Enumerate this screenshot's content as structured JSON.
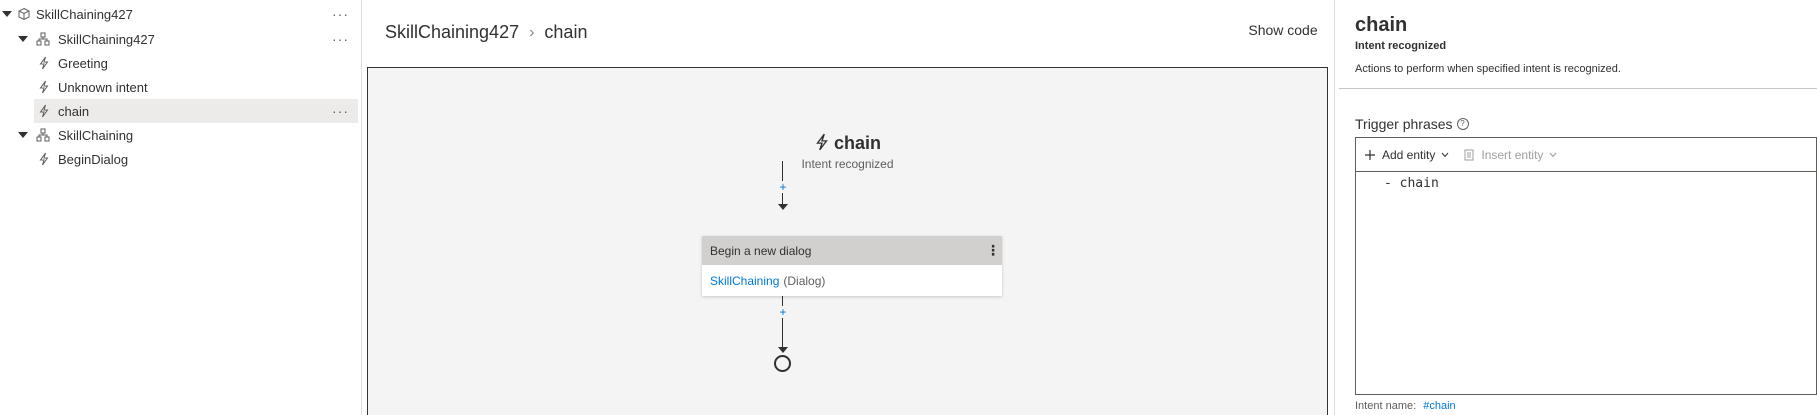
{
  "tree": {
    "items": [
      {
        "label": "SkillChaining427",
        "icon": "cube-icon",
        "more": "···"
      },
      {
        "label": "SkillChaining427",
        "icon": "dialog-hierarchy-icon",
        "more": "···"
      },
      {
        "label": "Greeting",
        "icon": "lightning-icon"
      },
      {
        "label": "Unknown intent",
        "icon": "lightning-icon"
      },
      {
        "label": "chain",
        "icon": "lightning-icon",
        "more": "···",
        "selected": true
      },
      {
        "label": "SkillChaining",
        "icon": "dialog-hierarchy-icon"
      },
      {
        "label": "BeginDialog",
        "icon": "lightning-icon"
      }
    ]
  },
  "header": {
    "breadcrumb": [
      "SkillChaining427",
      "chain"
    ],
    "breadcrumb_sep": "›",
    "show_code": "Show code"
  },
  "flow": {
    "trigger_title": "chain",
    "trigger_subtitle": "Intent recognized",
    "plus": "+",
    "action": {
      "title": "Begin a new dialog",
      "menu": "⋮",
      "target": "SkillChaining",
      "target_kind": "(Dialog)"
    }
  },
  "panel": {
    "title": "chain",
    "subtitle": "Intent recognized",
    "description": "Actions to perform when specified intent is recognized.",
    "trigger_phrases_label": "Trigger phrases",
    "info": "?",
    "add_entity": "Add entity",
    "insert_entity": "Insert entity",
    "code": "- chain",
    "intent_name_label": "Intent name:",
    "intent_name_value": "#chain"
  },
  "colors": {
    "accent": "#0078d4",
    "selected_row": "#edebe9",
    "canvas_bg": "#f4f4f4"
  }
}
